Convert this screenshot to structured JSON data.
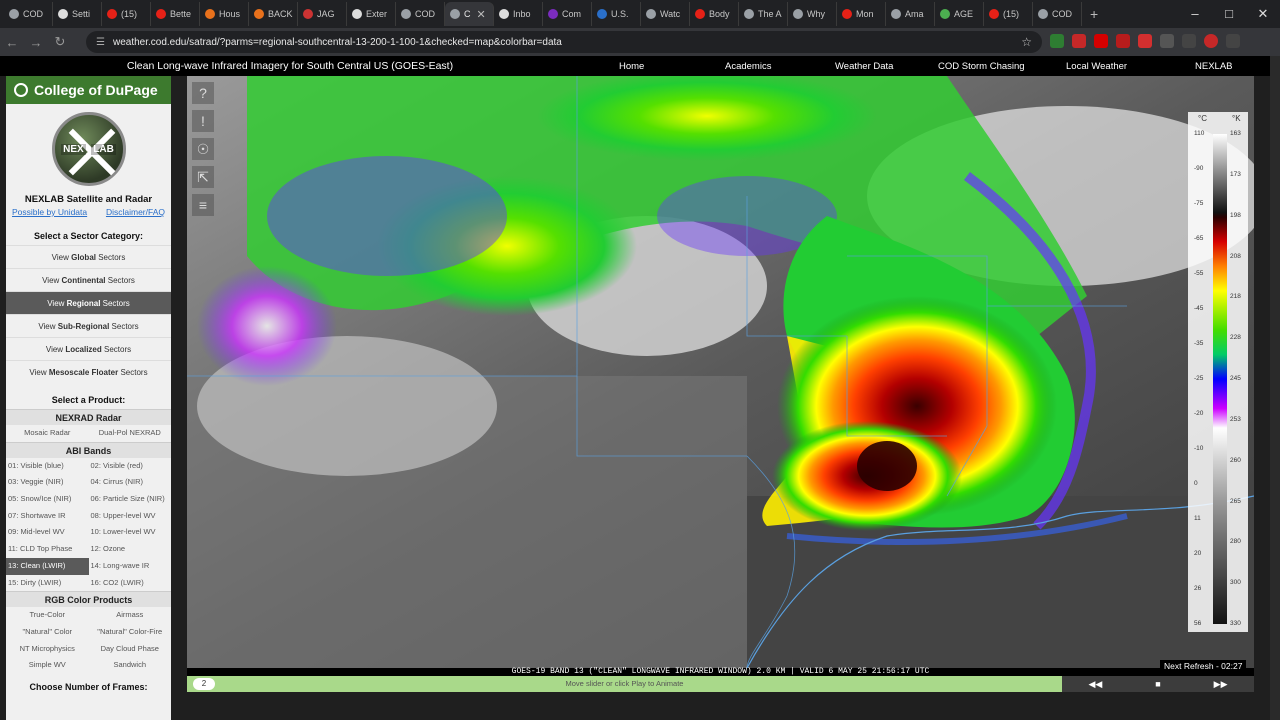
{
  "tabs": [
    {
      "label": "COD",
      "color": "#9aa0a6"
    },
    {
      "label": "Setti",
      "color": "#dddddd"
    },
    {
      "label": "(15)",
      "color": "#e62117"
    },
    {
      "label": "Bette",
      "color": "#e62117"
    },
    {
      "label": "Hous",
      "color": "#e8711c"
    },
    {
      "label": "BACK",
      "color": "#e8711c"
    },
    {
      "label": "JAG",
      "color": "#c33"
    },
    {
      "label": "Exter",
      "color": "#dddddd"
    },
    {
      "label": "COD",
      "color": "#9aa0a6"
    },
    {
      "label": "C",
      "color": "#9aa0a6",
      "active": true
    },
    {
      "label": "Inbo",
      "color": "#dddddd"
    },
    {
      "label": "Com",
      "color": "#7b2cbf"
    },
    {
      "label": "U.S.",
      "color": "#2a6fc9"
    },
    {
      "label": "Watc",
      "color": "#9aa0a6"
    },
    {
      "label": "Body",
      "color": "#e62117"
    },
    {
      "label": "The A",
      "color": "#9aa0a6"
    },
    {
      "label": "Why",
      "color": "#9aa0a6"
    },
    {
      "label": "Mon",
      "color": "#e62117"
    },
    {
      "label": "Ama",
      "color": "#9aa0a6"
    },
    {
      "label": "AGE",
      "color": "#4caf50"
    },
    {
      "label": "(15)",
      "color": "#e62117"
    },
    {
      "label": "COD",
      "color": "#9aa0a6"
    }
  ],
  "browser": {
    "url": "weather.cod.edu/satrad/?parms=regional-southcentral-13-200-1-100-1&checked=map&colorbar=data"
  },
  "header": {
    "title": "Clean Long-wave Infrared Imagery for South Central US (GOES-East)",
    "nav": [
      "Home",
      "Academics",
      "Weather Data",
      "COD Storm Chasing",
      "Local Weather",
      "NEXLAB"
    ]
  },
  "sidebar": {
    "logo": "College of DuPage",
    "seal_left": "NEX",
    "seal_right": "LAB",
    "title": "NEXLAB Satellite and Radar",
    "link_left": "Possible by Unidata",
    "link_right": "Disclaimer/FAQ",
    "sector_heading": "Select a Sector Category:",
    "sectors": [
      {
        "pre": "View ",
        "bold": "Global",
        "post": " Sectors"
      },
      {
        "pre": "View ",
        "bold": "Continental",
        "post": " Sectors"
      },
      {
        "pre": "View ",
        "bold": "Regional",
        "post": " Sectors",
        "active": true
      },
      {
        "pre": "View ",
        "bold": "Sub-Regional",
        "post": " Sectors"
      },
      {
        "pre": "View ",
        "bold": "Localized",
        "post": " Sectors"
      },
      {
        "pre": "View ",
        "bold": "Mesoscale Floater",
        "post": " Sectors"
      }
    ],
    "product_heading": "Select a Product:",
    "nexrad_heading": "NEXRAD Radar",
    "nexrad": [
      "Mosaic Radar",
      "Dual-Pol NEXRAD"
    ],
    "abi_heading": "ABI Bands",
    "abi": [
      "01: Visible (blue)",
      "02: Visible (red)",
      "03: Veggie (NIR)",
      "04: Cirrus (NIR)",
      "05: Snow/Ice (NIR)",
      "06: Particle Size (NIR)",
      "07: Shortwave IR",
      "08: Upper-level WV",
      "09: Mid-level WV",
      "10: Lower-level WV",
      "11: CLD Top Phase",
      "12: Ozone",
      "13: Clean (LWIR)",
      "14: Long-wave IR",
      "15: Dirty (LWIR)",
      "16: CO2 (LWIR)"
    ],
    "abi_selected": 12,
    "rgb_heading": "RGB Color Products",
    "rgb": [
      "True-Color",
      "Airmass",
      "\"Natural\" Color",
      "\"Natural\" Color-Fire",
      "NT Microphysics",
      "Day Cloud Phase",
      "Simple WV",
      "Sandwich"
    ],
    "frames_heading": "Choose Number of Frames:"
  },
  "map": {
    "valid_text": "GOES-19 BAND 13 (\"CLEAN\" LONGWAVE INFRARED WINDOW) 2.0 KM | VALID 6 MAY 25 21:56:17 UTC",
    "next_refresh": "Next Refresh - 02:27",
    "slider_frame": "2",
    "slider_hint": "Move slider or click Play to Animate"
  },
  "colorbar": {
    "unit_c": "°C",
    "unit_k": "°K",
    "celsius_ticks": [
      "110",
      "-90",
      "-75",
      "-65",
      "-55",
      "-45",
      "-35",
      "-25",
      "-20",
      "-10",
      "0",
      "11",
      "20",
      "26",
      "56"
    ],
    "kelvin_ticks": [
      "163",
      "173",
      "198",
      "208",
      "218",
      "228",
      "245",
      "253",
      "260",
      "265",
      "280",
      "300",
      "330"
    ]
  }
}
